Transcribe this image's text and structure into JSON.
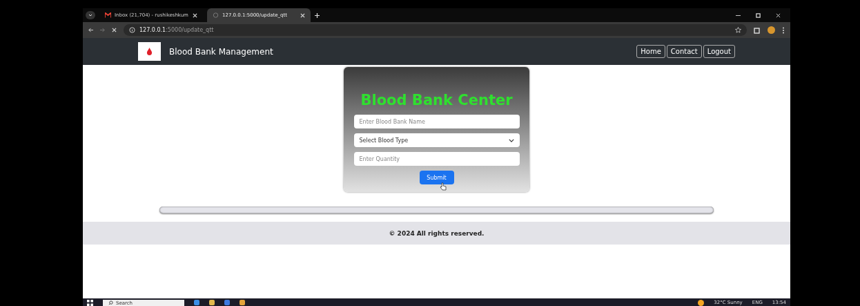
{
  "browser": {
    "tabs": [
      {
        "title": "Inbox (21,704) - rushikeshkum",
        "kind": "mail",
        "selected": false
      },
      {
        "title": "127.0.0.1:5000/update_qtt",
        "kind": "page",
        "selected": true
      }
    ],
    "address": {
      "host": "127.0.0.1",
      "path": ":5000/update_qtt"
    }
  },
  "navbar": {
    "brand": "Blood Bank Management",
    "links": [
      "Home",
      "Contact",
      "Logout"
    ]
  },
  "form": {
    "title": "Blood Bank Center",
    "fields": [
      {
        "kind": "text",
        "placeholder": "Enter Blood Bank Name"
      },
      {
        "kind": "select",
        "value": "Select Blood Type"
      },
      {
        "kind": "text",
        "placeholder": "Enter Quantity"
      }
    ],
    "submit": "Submit"
  },
  "footer": "© 2024 All rights reserved.",
  "taskbar": {
    "search": "Search",
    "weather": "32°C Sunny",
    "language": "ENG",
    "time": "13:54"
  }
}
